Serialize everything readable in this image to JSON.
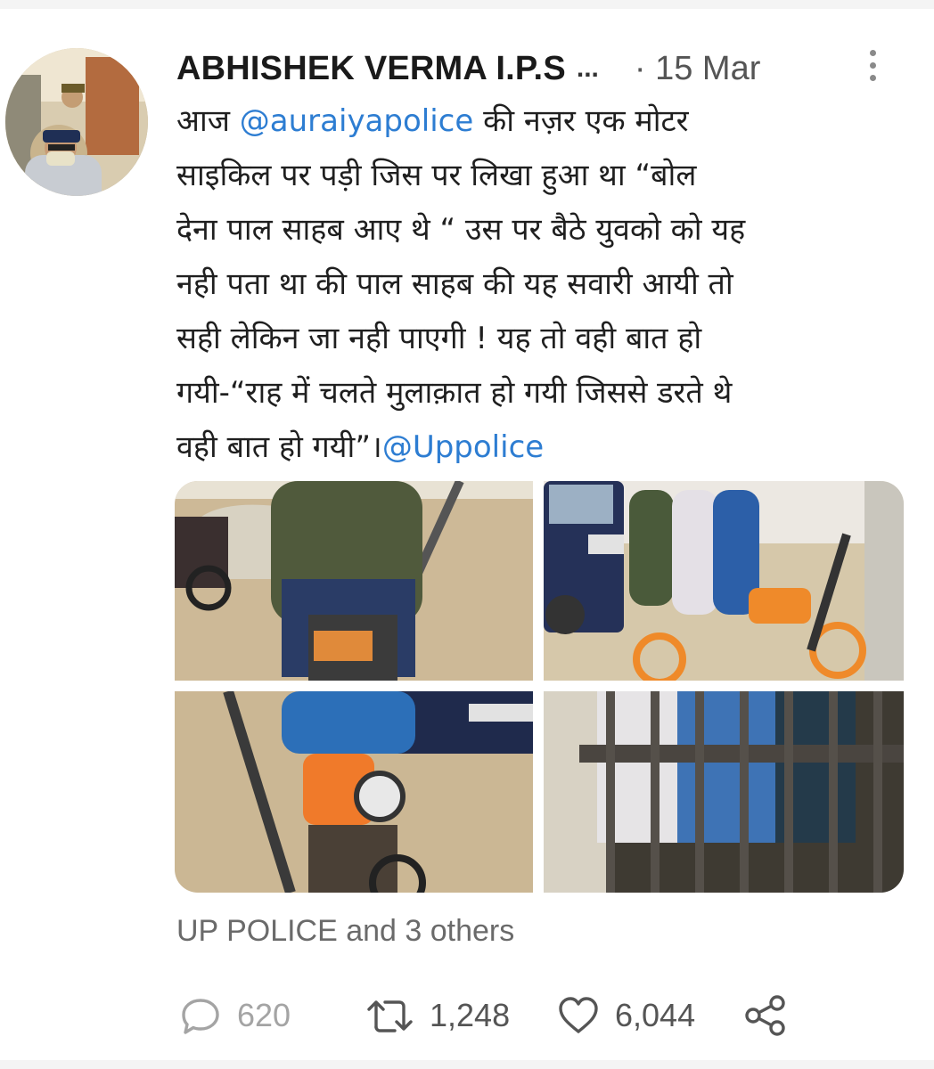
{
  "tweet": {
    "author_name": "ABHISHEK VERMA I.P.S",
    "name_ellipsis": "...",
    "date": "· 15 Mar",
    "text_lines": [
      [
        "आज ",
        "@auraiyapolice",
        "  की नज़र एक मोटर"
      ],
      [
        "साइकिल पर पड़ी जिस पर  लिखा हुआ था “बोल"
      ],
      [
        "देना पाल साहब आए थे “ उस पर बैठे युवको को यह"
      ],
      [
        "नही पता था की पाल साहब की यह सवारी  आयी तो"
      ],
      [
        "सही लेकिन जा नही पाएगी ! यह तो वही बात हो"
      ],
      [
        "गयी-“राह में चलते मुलाक़ात हो गयी जिससे डरते थे"
      ],
      [
        "वही बात हो गयी”।",
        "@Uppolice"
      ]
    ],
    "social_context": "UP POLICE and 3 others",
    "replies": "620",
    "retweets": "1,248",
    "likes": "6,044",
    "colors": {
      "mention": "#2d7dd2",
      "muted": "#6a6a6a"
    }
  },
  "icons": [
    "more-vertical-icon",
    "reply-icon",
    "retweet-icon",
    "like-icon",
    "share-icon"
  ]
}
